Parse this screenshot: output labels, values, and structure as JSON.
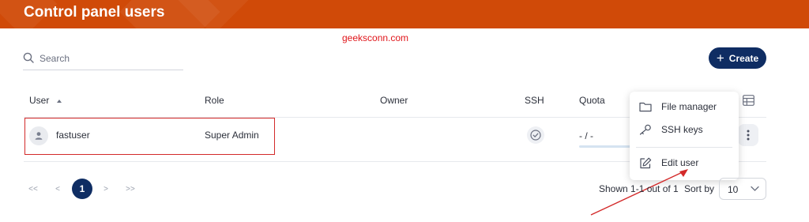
{
  "header": {
    "title": "Control panel users"
  },
  "watermark": "geeksconn.com",
  "search": {
    "placeholder": "Search",
    "value": ""
  },
  "create_label": "Create",
  "columns": {
    "user": "User",
    "role": "Role",
    "owner": "Owner",
    "ssh": "SSH",
    "quota": "Quota"
  },
  "rows": [
    {
      "user": "fastuser",
      "role": "Super Admin",
      "owner": "",
      "ssh": "enabled",
      "quota": "- / -"
    }
  ],
  "context_menu": {
    "items": [
      {
        "label": "File manager",
        "icon": "folder-icon"
      },
      {
        "label": "SSH keys",
        "icon": "key-icon"
      },
      {
        "label": "Edit user",
        "icon": "edit-icon"
      }
    ]
  },
  "pagination": {
    "first": "<<",
    "prev": "<",
    "current": "1",
    "next": ">",
    "last": ">>"
  },
  "footer": {
    "shown_text": "Shown 1-1 out of 1",
    "sort_label": "Sort by",
    "per_page_value": "10"
  },
  "colors": {
    "header": "#d04a08",
    "primary": "#0f2d63",
    "annotation": "#d32a2a"
  }
}
